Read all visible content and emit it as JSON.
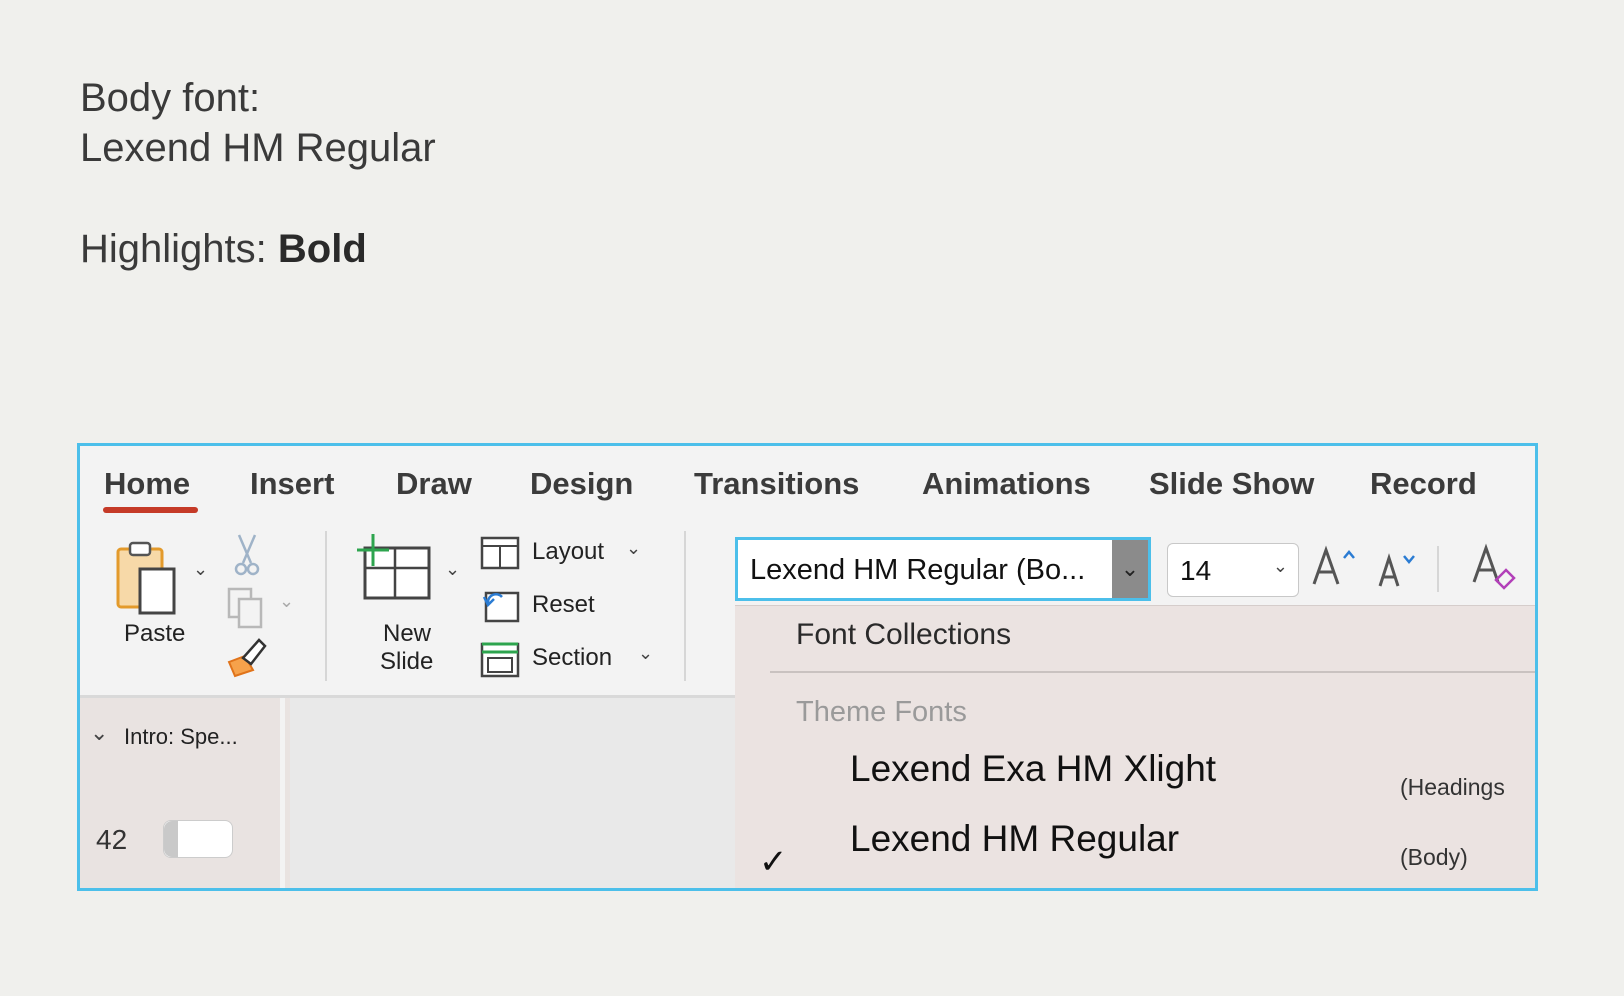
{
  "intro": {
    "body_label": "Body font:",
    "body_value": "Lexend HM Regular",
    "highlights_label": "Highlights:",
    "highlights_value": "Bold"
  },
  "tabs": [
    "Home",
    "Insert",
    "Draw",
    "Design",
    "Transitions",
    "Animations",
    "Slide Show",
    "Record"
  ],
  "ribbon": {
    "paste_label": "Paste",
    "new_slide_line1": "New",
    "new_slide_line2": "Slide",
    "layout_label": "Layout",
    "reset_label": "Reset",
    "section_label": "Section",
    "font_name": "Lexend HM Regular (Bo...",
    "font_size": "14"
  },
  "font_menu": {
    "collections_label": "Font Collections",
    "theme_label": "Theme Fonts",
    "heading_font": "Lexend Exa HM Xlight",
    "heading_tag": "(Headings",
    "body_font": "Lexend HM Regular",
    "body_tag": "(Body)"
  },
  "slides_panel": {
    "section_label": "Intro: Spe...",
    "slide_number": "42"
  },
  "colors": {
    "accent_border": "#4cbfea",
    "active_tab_underline": "#c53a27",
    "menu_background": "#ebe3e1"
  }
}
